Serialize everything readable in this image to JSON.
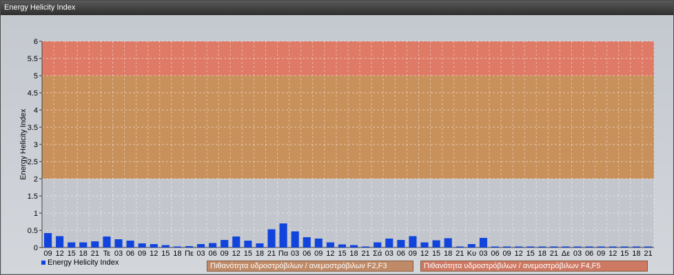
{
  "window": {
    "title": "Energy Helicity Index"
  },
  "legend": {
    "series_label": "Energy Helicity Index",
    "band1_label": "Πιθανότητα υδροστρόβιλων / ανεμοστρόβιλων F2,F3",
    "band2_label": "Πιθανότητα υδροστρόβιλων / ανεμοστρόβιλων F4,F5"
  },
  "colors": {
    "series": "#1144dd",
    "band_low": "#c8905a",
    "band_high": "#de7a66",
    "band1_legend": "#bf8a67",
    "band2_legend": "#cd7964"
  },
  "chart_data": {
    "type": "bar",
    "ylabel": "Energy Helicity Index",
    "xlabel": "",
    "ylim": [
      0,
      6
    ],
    "yticks": [
      "0",
      "0.5",
      "1",
      "1.5",
      "2",
      "2.5",
      "3",
      "3.5",
      "4",
      "4.5",
      "5",
      "5.5",
      "6"
    ],
    "grid": true,
    "legend_position": "bottom-left",
    "plot_bands": [
      {
        "from": 2,
        "to": 5,
        "color": "#c8905a"
      },
      {
        "from": 5,
        "to": 6,
        "color": "#de7a66"
      }
    ],
    "categories": [
      "09",
      "12",
      "15",
      "18",
      "21",
      "Τε",
      "03",
      "06",
      "09",
      "12",
      "15",
      "18",
      "Πε",
      "03",
      "06",
      "09",
      "12",
      "15",
      "18",
      "21",
      "Πα",
      "03",
      "06",
      "09",
      "12",
      "15",
      "18",
      "21",
      "Σά",
      "03",
      "06",
      "09",
      "12",
      "15",
      "18",
      "21",
      "Κυ",
      "03",
      "06",
      "09",
      "12",
      "15",
      "18",
      "21",
      "Δε",
      "03",
      "06",
      "09",
      "12",
      "15",
      "18",
      "21"
    ],
    "values": [
      0.42,
      0.33,
      0.15,
      0.15,
      0.18,
      0.32,
      0.24,
      0.2,
      0.12,
      0.1,
      0.07,
      0.03,
      0.04,
      0.1,
      0.13,
      0.22,
      0.32,
      0.2,
      0.12,
      0.53,
      0.7,
      0.47,
      0.3,
      0.26,
      0.15,
      0.09,
      0.07,
      0.03,
      0.15,
      0.26,
      0.22,
      0.33,
      0.15,
      0.21,
      0.27,
      0.03,
      0.1,
      0.28,
      0.03,
      0.03,
      0.03,
      0.03,
      0.03,
      0.03,
      0.03,
      0.03,
      0.03,
      0.03,
      0.03,
      0.03,
      0.03,
      0.03
    ]
  }
}
